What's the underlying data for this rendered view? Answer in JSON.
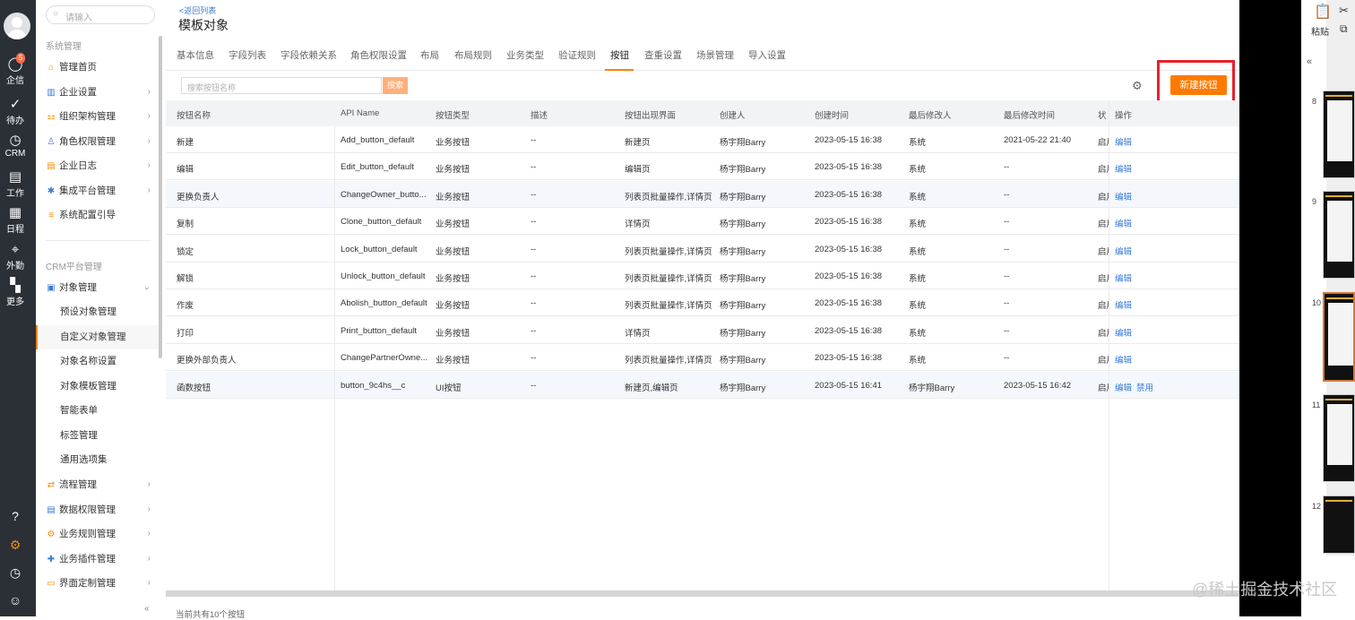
{
  "rail": {
    "badge": "5",
    "items": [
      {
        "label": "企信",
        "icon": "chat-icon"
      },
      {
        "label": "待办",
        "icon": "check-circle-icon"
      },
      {
        "label": "CRM",
        "icon": "clock-icon"
      },
      {
        "label": "工作",
        "icon": "briefcase-icon"
      },
      {
        "label": "日程",
        "icon": "calendar-icon"
      },
      {
        "label": "外勤",
        "icon": "location-icon"
      },
      {
        "label": "更多",
        "icon": "grid-icon"
      }
    ]
  },
  "sidebar": {
    "search_placeholder": "请输入",
    "section1": "系统管理",
    "items1": [
      {
        "label": "管理首页",
        "icon": "home-icon"
      },
      {
        "label": "企业设置",
        "icon": "company-icon"
      },
      {
        "label": "组织架构管理",
        "icon": "org-icon"
      },
      {
        "label": "角色权限管理",
        "icon": "role-icon"
      },
      {
        "label": "企业日志",
        "icon": "log-icon"
      },
      {
        "label": "集成平台管理",
        "icon": "integration-icon"
      },
      {
        "label": "系统配置引导",
        "icon": "guide-icon"
      }
    ],
    "section2": "CRM平台管理",
    "object_mgmt": "对象管理",
    "subs": [
      "预设对象管理",
      "自定义对象管理",
      "对象名称设置",
      "对象模板管理",
      "智能表单",
      "标签管理",
      "通用选项集"
    ],
    "items2": [
      {
        "label": "流程管理",
        "icon": "flow-icon"
      },
      {
        "label": "数据权限管理",
        "icon": "data-perm-icon"
      },
      {
        "label": "业务规则管理",
        "icon": "rule-icon"
      },
      {
        "label": "业务插件管理",
        "icon": "plugin-icon"
      },
      {
        "label": "界面定制管理",
        "icon": "ui-custom-icon"
      }
    ]
  },
  "header": {
    "back": "<返回列表",
    "title": "模板对象"
  },
  "tabs": [
    "基本信息",
    "字段列表",
    "字段依赖关系",
    "角色权限设置",
    "布局",
    "布局规则",
    "业务类型",
    "验证规则",
    "按钮",
    "查重设置",
    "场景管理",
    "导入设置"
  ],
  "active_tab": "按钮",
  "toolbar": {
    "search_placeholder": "搜索按钮名称",
    "search_btn": "搜索",
    "new_btn": "新建按钮"
  },
  "table": {
    "columns": [
      "按钮名称",
      "API Name",
      "按钮类型",
      "描述",
      "按钮出现界面",
      "创建人",
      "创建时间",
      "最后修改人",
      "最后修改时间",
      "状",
      "操作"
    ],
    "rows": [
      {
        "name": "新建",
        "api": "Add_button_default",
        "type": "业务按钮",
        "desc": "--",
        "ui": "新建页",
        "creator": "杨宇翔Barry",
        "created": "2023-05-15 16:38",
        "modifier": "系统",
        "modified": "2021-05-22 21:40",
        "status": "启用",
        "edit": "编辑",
        "disable": ""
      },
      {
        "name": "编辑",
        "api": "Edit_button_default",
        "type": "业务按钮",
        "desc": "--",
        "ui": "编辑页",
        "creator": "杨宇翔Barry",
        "created": "2023-05-15 16:38",
        "modifier": "系统",
        "modified": "--",
        "status": "启用",
        "edit": "编辑",
        "disable": ""
      },
      {
        "name": "更换负责人",
        "api": "ChangeOwner_butto...",
        "type": "业务按钮",
        "desc": "--",
        "ui": "列表页批量操作,详情页",
        "creator": "杨宇翔Barry",
        "created": "2023-05-15 16:38",
        "modifier": "系统",
        "modified": "--",
        "status": "启用",
        "edit": "编辑",
        "disable": ""
      },
      {
        "name": "复制",
        "api": "Clone_button_default",
        "type": "业务按钮",
        "desc": "--",
        "ui": "详情页",
        "creator": "杨宇翔Barry",
        "created": "2023-05-15 16:38",
        "modifier": "系统",
        "modified": "--",
        "status": "启用",
        "edit": "编辑",
        "disable": ""
      },
      {
        "name": "锁定",
        "api": "Lock_button_default",
        "type": "业务按钮",
        "desc": "--",
        "ui": "列表页批量操作,详情页",
        "creator": "杨宇翔Barry",
        "created": "2023-05-15 16:38",
        "modifier": "系统",
        "modified": "--",
        "status": "启用",
        "edit": "编辑",
        "disable": ""
      },
      {
        "name": "解锁",
        "api": "Unlock_button_default",
        "type": "业务按钮",
        "desc": "--",
        "ui": "列表页批量操作,详情页",
        "creator": "杨宇翔Barry",
        "created": "2023-05-15 16:38",
        "modifier": "系统",
        "modified": "--",
        "status": "启用",
        "edit": "编辑",
        "disable": ""
      },
      {
        "name": "作废",
        "api": "Abolish_button_default",
        "type": "业务按钮",
        "desc": "--",
        "ui": "列表页批量操作,详情页",
        "creator": "杨宇翔Barry",
        "created": "2023-05-15 16:38",
        "modifier": "系统",
        "modified": "--",
        "status": "启用",
        "edit": "编辑",
        "disable": ""
      },
      {
        "name": "打印",
        "api": "Print_button_default",
        "type": "业务按钮",
        "desc": "--",
        "ui": "详情页",
        "creator": "杨宇翔Barry",
        "created": "2023-05-15 16:38",
        "modifier": "系统",
        "modified": "--",
        "status": "启用",
        "edit": "编辑",
        "disable": ""
      },
      {
        "name": "更换外部负责人",
        "api": "ChangePartnerOwne...",
        "type": "业务按钮",
        "desc": "--",
        "ui": "列表页批量操作,详情页",
        "creator": "杨宇翔Barry",
        "created": "2023-05-15 16:38",
        "modifier": "系统",
        "modified": "--",
        "status": "启用",
        "edit": "编辑",
        "disable": ""
      },
      {
        "name": "函数按钮",
        "api": "button_9c4hs__c",
        "type": "UI按钮",
        "desc": "--",
        "ui": "新建页,编辑页",
        "creator": "杨宇翔Barry",
        "created": "2023-05-15 16:41",
        "modifier": "杨宇翔Barry",
        "modified": "2023-05-15 16:42",
        "status": "启用",
        "edit": "编辑",
        "disable": "禁用"
      }
    ],
    "footer": "当前共有10个按钮"
  },
  "right_panel": {
    "paste": "粘贴",
    "slides": [
      "8",
      "9",
      "10",
      "11",
      "12"
    ]
  },
  "watermark": "@稀土掘金技术社区",
  "colors": {
    "accent": "#ff7a00",
    "link": "#3a7bd5",
    "highlight_box": "#e8202a",
    "rail": "#2b2f36"
  }
}
